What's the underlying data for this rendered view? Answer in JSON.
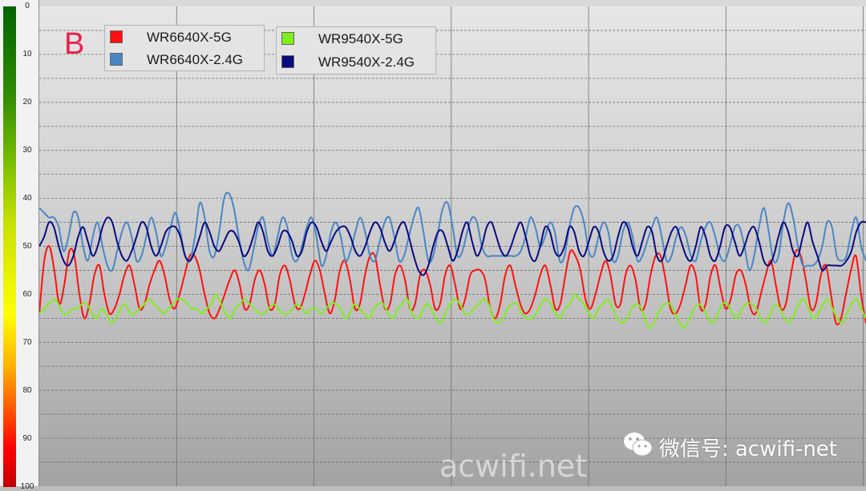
{
  "panel_label": "B",
  "scale_ticks": [
    "0",
    "10",
    "20",
    "30",
    "40",
    "50",
    "60",
    "70",
    "80",
    "90",
    "100"
  ],
  "legend": [
    {
      "label": "WR6640X-5G",
      "color": "#ff1010"
    },
    {
      "label": "WR6640X-2.4G",
      "color": "#4a86c5"
    },
    {
      "label": "WR9540X-5G",
      "color": "#80ee1a"
    },
    {
      "label": "WR9540X-2.4G",
      "color": "#0a0a80"
    }
  ],
  "watermarks": {
    "wechat": "微信号: acwifi-net",
    "wechat_icon": "wechat-icon",
    "site": "acwifi.net"
  },
  "chart_data": {
    "type": "line",
    "title": "",
    "xlabel": "",
    "ylabel": "",
    "ylim": [
      0,
      100
    ],
    "y_inverted": true,
    "grid": true,
    "legend_position": "top-left",
    "series": [
      {
        "name": "WR6640X-5G",
        "color": "#ff1010",
        "values": [
          64,
          53,
          50,
          55,
          62,
          58,
          51,
          52,
          60,
          65,
          62,
          56,
          54,
          60,
          64,
          63,
          60,
          56,
          54,
          58,
          63,
          62,
          58,
          55,
          53,
          56,
          61,
          63,
          60,
          56,
          52,
          52,
          55,
          60,
          64,
          65,
          63,
          60,
          57,
          55,
          58,
          63,
          62,
          57,
          55,
          58,
          63,
          62,
          56,
          54,
          57,
          62,
          63,
          60,
          56,
          53,
          55,
          60,
          64,
          61,
          55,
          53,
          57,
          63,
          62,
          56,
          52,
          52,
          58,
          63,
          62,
          56,
          54,
          57,
          63,
          62,
          56,
          55,
          58,
          63,
          62,
          56,
          54,
          58,
          63,
          61,
          56,
          55,
          55,
          57,
          63,
          65,
          62,
          56,
          54,
          58,
          62,
          64,
          63,
          60,
          56,
          54,
          58,
          63,
          62,
          56,
          51,
          52,
          55,
          61,
          63,
          60,
          56,
          53,
          56,
          62,
          62,
          56,
          54,
          57,
          63,
          62,
          56,
          52,
          52,
          57,
          63,
          64,
          62,
          58,
          54,
          56,
          63,
          62,
          56,
          54,
          59,
          63,
          61,
          56,
          55,
          58,
          63,
          64,
          60,
          56,
          53,
          58,
          63,
          62,
          56,
          51,
          52,
          57,
          63,
          62,
          56,
          54,
          60,
          66,
          65,
          60,
          55,
          52,
          60,
          66
        ]
      },
      {
        "name": "WR6640X-2.4G",
        "color": "#4a86c5",
        "values": [
          42,
          43,
          44,
          44,
          46,
          51,
          48,
          43,
          44,
          50,
          53,
          48,
          45,
          50,
          54,
          55,
          51,
          47,
          45,
          48,
          53,
          52,
          48,
          44,
          47,
          52,
          50,
          46,
          43,
          47,
          52,
          53,
          48,
          41,
          44,
          51,
          52,
          47,
          40,
          39,
          42,
          48,
          53,
          55,
          51,
          46,
          44,
          49,
          52,
          48,
          44,
          46,
          52,
          53,
          50,
          46,
          44,
          48,
          54,
          52,
          47,
          45,
          48,
          53,
          51,
          47,
          44,
          47,
          52,
          53,
          49,
          45,
          44,
          48,
          53,
          52,
          48,
          44,
          42,
          47,
          53,
          52,
          47,
          42,
          41,
          46,
          52,
          51,
          47,
          44,
          45,
          50,
          52,
          52,
          52,
          52,
          52,
          52,
          52,
          51,
          48,
          44,
          46,
          50,
          48,
          45,
          47,
          53,
          52,
          46,
          42,
          42,
          45,
          51,
          52,
          48,
          45,
          47,
          53,
          52,
          47,
          45,
          48,
          53,
          52,
          49,
          46,
          44,
          48,
          53,
          52,
          48,
          46,
          48,
          52,
          53,
          49,
          46,
          45,
          48,
          52,
          53,
          50,
          46,
          46,
          50,
          55,
          52,
          46,
          42,
          47,
          53,
          52,
          45,
          41,
          44,
          50,
          54,
          54,
          54,
          53,
          50,
          45,
          46,
          52,
          53,
          52,
          47,
          44,
          50,
          53
        ]
      },
      {
        "name": "WR9540X-5G",
        "color": "#80ee1a",
        "values": [
          64,
          63,
          62,
          61,
          62,
          64,
          64,
          63,
          63,
          62,
          62,
          64,
          65,
          63,
          64,
          66,
          65,
          63,
          62,
          64,
          64,
          63,
          62,
          61,
          62,
          63,
          64,
          63,
          62,
          61,
          61,
          62,
          63,
          63,
          64,
          63,
          62,
          60,
          62,
          64,
          65,
          63,
          62,
          61,
          62,
          63,
          64,
          64,
          63,
          62,
          63,
          64,
          64,
          63,
          62,
          63,
          64,
          63,
          63,
          64,
          63,
          62,
          62,
          63,
          65,
          64,
          62,
          63,
          64,
          65,
          63,
          62,
          62,
          64,
          65,
          63,
          62,
          61,
          64,
          65,
          64,
          62,
          63,
          65,
          66,
          64,
          62,
          61,
          62,
          64,
          64,
          63,
          62,
          61,
          62,
          65,
          66,
          65,
          63,
          62,
          62,
          64,
          65,
          65,
          64,
          62,
          61,
          62,
          64,
          65,
          63,
          62,
          60,
          61,
          62,
          64,
          65,
          63,
          62,
          61,
          63,
          65,
          66,
          65,
          63,
          62,
          63,
          66,
          67,
          65,
          63,
          62,
          62,
          64,
          66,
          67,
          65,
          63,
          62,
          63,
          65,
          66,
          64,
          62,
          62,
          64,
          65,
          63,
          62,
          62,
          63,
          65,
          66,
          64,
          62,
          63,
          65,
          66,
          64,
          62,
          61,
          63,
          65,
          64,
          62,
          61,
          63,
          65,
          66,
          64,
          62,
          61,
          63,
          65
        ]
      },
      {
        "name": "WR9540X-2.4G",
        "color": "#0a0a80",
        "values": [
          50,
          48,
          45,
          46,
          50,
          53,
          54,
          52,
          48,
          46,
          49,
          52,
          50,
          46,
          44,
          45,
          49,
          52,
          53,
          51,
          48,
          45,
          46,
          50,
          52,
          50,
          47,
          46,
          46,
          48,
          52,
          53,
          51,
          48,
          45,
          47,
          50,
          51,
          49,
          47,
          47,
          49,
          52,
          51,
          48,
          45,
          47,
          51,
          52,
          50,
          47,
          47,
          49,
          52,
          51,
          47,
          45,
          46,
          49,
          51,
          49,
          47,
          46,
          46,
          48,
          51,
          52,
          50,
          47,
          45,
          46,
          49,
          51,
          49,
          46,
          45,
          48,
          52,
          55,
          56,
          54,
          50,
          47,
          47,
          50,
          53,
          51,
          47,
          45,
          49,
          52,
          50,
          46,
          45,
          48,
          51,
          52,
          50,
          47,
          45,
          48,
          52,
          53,
          50,
          46,
          47,
          51,
          52,
          50,
          46,
          47,
          51,
          52,
          49,
          46,
          47,
          51,
          53,
          52,
          48,
          45,
          46,
          50,
          52,
          49,
          46,
          47,
          52,
          53,
          50,
          47,
          46,
          49,
          52,
          53,
          50,
          46,
          48,
          52,
          53,
          50,
          46,
          46,
          49,
          52,
          50,
          47,
          46,
          49,
          53,
          54,
          52,
          48,
          45,
          47,
          51,
          52,
          48,
          45,
          49,
          52,
          55,
          54,
          54,
          54,
          54,
          53,
          51,
          47,
          45,
          45
        ]
      }
    ]
  }
}
